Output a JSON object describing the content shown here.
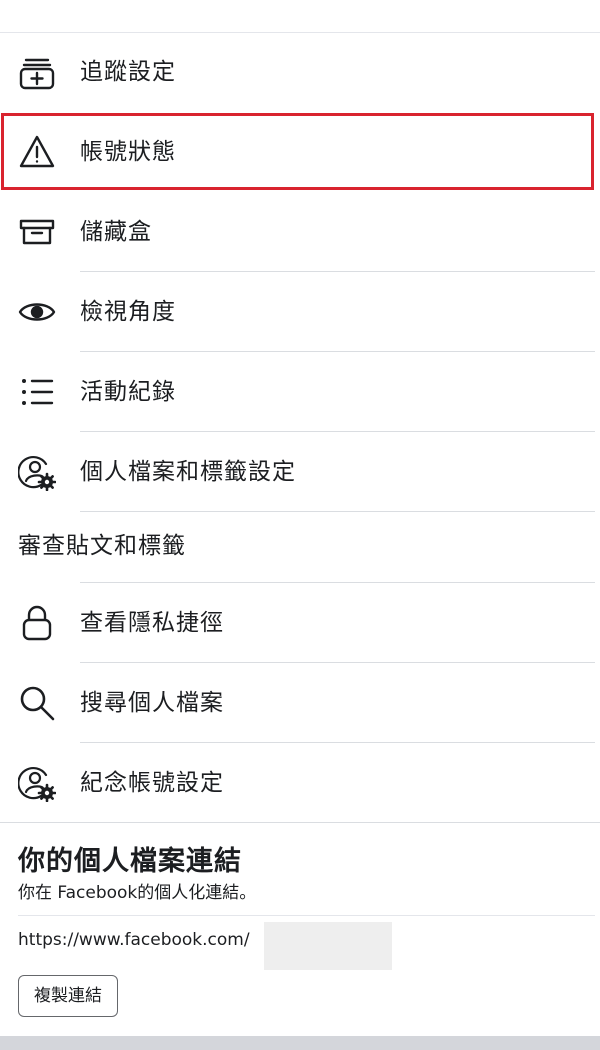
{
  "menu": {
    "items": [
      {
        "label": "追蹤設定",
        "icon": "follow-settings-icon"
      },
      {
        "label": "帳號狀態",
        "icon": "warning-icon"
      },
      {
        "label": "儲藏盒",
        "icon": "archive-icon"
      },
      {
        "label": "檢視角度",
        "icon": "eye-icon"
      },
      {
        "label": "活動紀錄",
        "icon": "list-icon"
      },
      {
        "label": "個人檔案和標籤設定",
        "icon": "profile-settings-icon"
      },
      {
        "label": "審查貼文和標籤",
        "icon": ""
      },
      {
        "label": "查看隱私捷徑",
        "icon": "lock-icon"
      },
      {
        "label": "搜尋個人檔案",
        "icon": "search-icon"
      },
      {
        "label": "紀念帳號設定",
        "icon": "memorial-settings-icon"
      }
    ]
  },
  "profile_link_section": {
    "title": "你的個人檔案連結",
    "subtitle": "你在 Facebook的個人化連結。",
    "url": "https://www.facebook.com/",
    "copy_button": "複製連結"
  },
  "colors": {
    "highlight": "#d9232e",
    "divider": "#dadde1",
    "text": "#1c1e21"
  }
}
